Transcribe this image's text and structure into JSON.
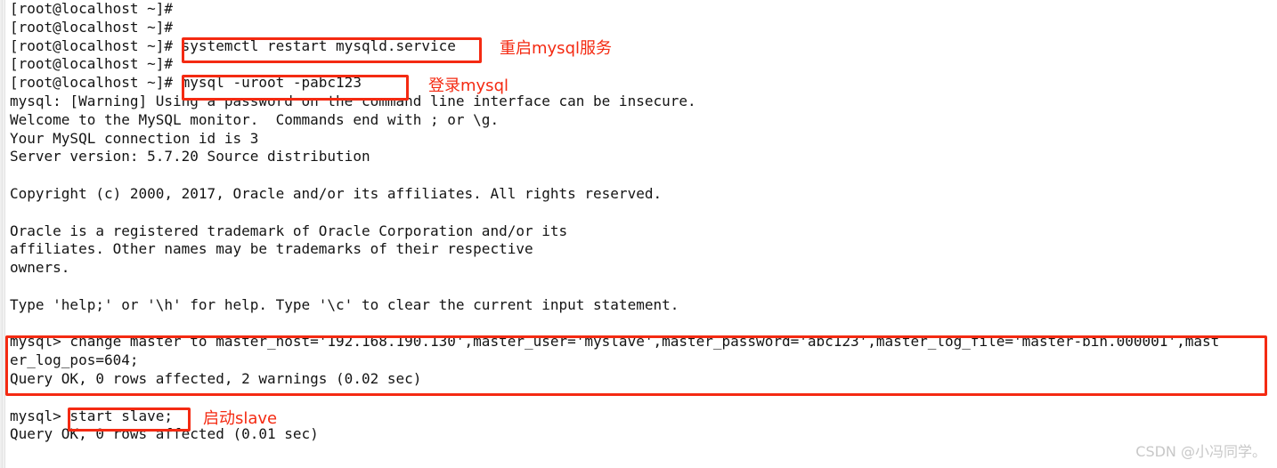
{
  "terminal": {
    "background_color": "#ffffff",
    "text_color": "#141414",
    "annotation_color": "#f42a12",
    "lines": [
      {
        "id": "l0",
        "text": "[root@localhost ~]#"
      },
      {
        "id": "l1",
        "text": "[root@localhost ~]#"
      },
      {
        "id": "l2",
        "text": "[root@localhost ~]# systemctl restart mysqld.service"
      },
      {
        "id": "l3",
        "text": "[root@localhost ~]#"
      },
      {
        "id": "l4",
        "text": "[root@localhost ~]# mysql -uroot -pabc123"
      },
      {
        "id": "l5",
        "text": "mysql: [Warning] Using a password on the command line interface can be insecure."
      },
      {
        "id": "l6",
        "text": "Welcome to the MySQL monitor.  Commands end with ; or \\g."
      },
      {
        "id": "l7",
        "text": "Your MySQL connection id is 3"
      },
      {
        "id": "l8",
        "text": "Server version: 5.7.20 Source distribution"
      },
      {
        "id": "l9",
        "text": ""
      },
      {
        "id": "l10",
        "text": "Copyright (c) 2000, 2017, Oracle and/or its affiliates. All rights reserved."
      },
      {
        "id": "l11",
        "text": ""
      },
      {
        "id": "l12",
        "text": "Oracle is a registered trademark of Oracle Corporation and/or its"
      },
      {
        "id": "l13",
        "text": "affiliates. Other names may be trademarks of their respective"
      },
      {
        "id": "l14",
        "text": "owners."
      },
      {
        "id": "l15",
        "text": ""
      },
      {
        "id": "l16",
        "text": "Type 'help;' or '\\h' for help. Type '\\c' to clear the current input statement."
      },
      {
        "id": "l17",
        "text": ""
      },
      {
        "id": "l18",
        "text": "mysql> change master to master_host='192.168.190.130',master_user='myslave',master_password='abc123',master_log_file='master-bin.000001',mast"
      },
      {
        "id": "l19",
        "text": "er_log_pos=604;"
      },
      {
        "id": "l20",
        "text": "Query OK, 0 rows affected, 2 warnings (0.02 sec)"
      },
      {
        "id": "l21",
        "text": ""
      },
      {
        "id": "l22",
        "text": "mysql> start slave;"
      },
      {
        "id": "l23",
        "text": "Query OK, 0 rows affected (0.01 sec)"
      }
    ]
  },
  "annotations": {
    "labels": [
      {
        "id": "restart-service",
        "text": "重启mysql服务"
      },
      {
        "id": "login-mysql",
        "text": "登录mysql"
      },
      {
        "id": "start-slave",
        "text": "启动slave"
      }
    ],
    "highlight_boxes": [
      {
        "id": "systemctl-restart-command",
        "target": "systemctl restart mysqld.service"
      },
      {
        "id": "mysql-login-command",
        "target": "mysql -uroot -pabc123"
      },
      {
        "id": "change-master-statement",
        "target": "change master to ... er_log_pos=604;"
      },
      {
        "id": "start-slave-command",
        "target": "start slave;"
      }
    ]
  },
  "watermark": {
    "text": "CSDN @小冯同学。"
  }
}
